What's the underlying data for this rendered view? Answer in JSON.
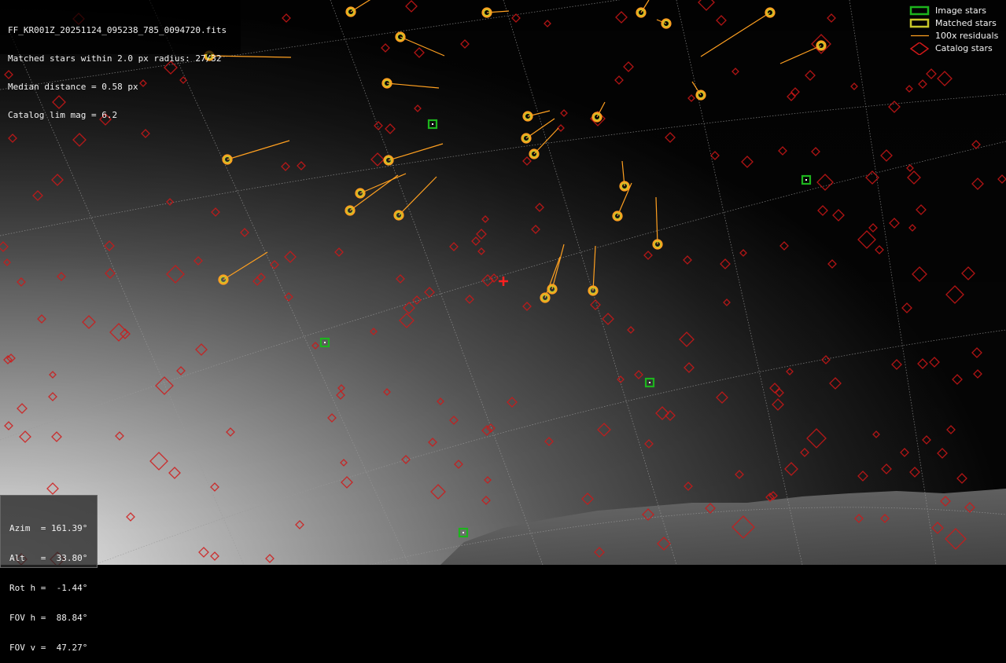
{
  "info": {
    "filename": "FF_KR001Z_20251124_095238_785_0094720.fits",
    "matched": "Matched stars within 2.0 px radius: 27/32",
    "median": "Median distance = 0.58 px",
    "catalog_lim": "Catalog lim mag = 6.2"
  },
  "pointing": {
    "azim": "Azim  = 161.39°",
    "alt": "Alt   =  33.80°",
    "rot_h": "Rot h =  -1.44°",
    "fov_h": "FOV h =  88.84°",
    "fov_v": "FOV v =  47.27°"
  },
  "legend": {
    "image_stars": "Image stars",
    "matched_stars": "Matched stars",
    "residuals": "100x residuals",
    "catalog_stars": "Catalog stars"
  },
  "colors": {
    "image_star": "#1db41d",
    "matched_star": "#c8c82a",
    "residual": "#ffa020",
    "catalog_star": "#d01818",
    "center_marker": "#ff2020",
    "grid": "#9a9a9a"
  },
  "markers": {
    "image_stars": [
      [
        550,
        158
      ],
      [
        413,
        436
      ],
      [
        826,
        487
      ],
      [
        1025,
        229
      ],
      [
        589,
        678
      ]
    ],
    "matched_stars": [
      {
        "star": [
          446,
          15
        ],
        "tip": [
          478,
          -5
        ]
      },
      {
        "star": [
          619,
          16
        ],
        "tip": [
          647,
          14
        ]
      },
      {
        "star": [
          815,
          16
        ],
        "tip": [
          825,
          0
        ]
      },
      {
        "star": [
          847,
          30
        ],
        "tip": [
          835,
          25
        ]
      },
      {
        "star": [
          979,
          16
        ],
        "tip": [
          891,
          72
        ]
      },
      {
        "star": [
          1044,
          58
        ],
        "tip": [
          992,
          81
        ]
      },
      {
        "star": [
          509,
          47
        ],
        "tip": [
          565,
          71
        ]
      },
      {
        "star": [
          266,
          71
        ],
        "tip": [
          370,
          73
        ]
      },
      {
        "star": [
          492,
          106
        ],
        "tip": [
          558,
          112
        ]
      },
      {
        "star": [
          891,
          121
        ],
        "tip": [
          880,
          104
        ]
      },
      {
        "star": [
          671,
          148
        ],
        "tip": [
          699,
          141
        ]
      },
      {
        "star": [
          759,
          149
        ],
        "tip": [
          769,
          130
        ]
      },
      {
        "star": [
          669,
          176
        ],
        "tip": [
          705,
          151
        ]
      },
      {
        "star": [
          679,
          196
        ],
        "tip": [
          710,
          163
        ]
      },
      {
        "star": [
          289,
          203
        ],
        "tip": [
          368,
          179
        ]
      },
      {
        "star": [
          494,
          204
        ],
        "tip": [
          563,
          183
        ]
      },
      {
        "star": [
          794,
          237
        ],
        "tip": [
          791,
          205
        ]
      },
      {
        "star": [
          458,
          246
        ],
        "tip": [
          516,
          221
        ]
      },
      {
        "star": [
          445,
          268
        ],
        "tip": [
          506,
          223
        ]
      },
      {
        "star": [
          507,
          274
        ],
        "tip": [
          555,
          225
        ]
      },
      {
        "star": [
          785,
          275
        ],
        "tip": [
          803,
          233
        ]
      },
      {
        "star": [
          836,
          311
        ],
        "tip": [
          834,
          251
        ]
      },
      {
        "star": [
          284,
          356
        ],
        "tip": [
          340,
          321
        ]
      },
      {
        "star": [
          702,
          368
        ],
        "tip": [
          717,
          311
        ]
      },
      {
        "star": [
          754,
          370
        ],
        "tip": [
          757,
          313
        ]
      },
      {
        "star": [
          693,
          379
        ],
        "tip": [
          712,
          327
        ]
      }
    ],
    "center": [
      640,
      358
    ],
    "catalog_stars": [
      [
        523,
        8,
        7
      ],
      [
        364,
        23,
        5
      ],
      [
        656,
        23,
        5
      ],
      [
        696,
        30,
        4
      ],
      [
        790,
        22,
        7
      ],
      [
        898,
        3,
        10
      ],
      [
        917,
        26,
        6
      ],
      [
        1057,
        23,
        5
      ],
      [
        591,
        56,
        5
      ],
      [
        490,
        61,
        5
      ],
      [
        533,
        67,
        6
      ],
      [
        1044,
        56,
        12
      ],
      [
        217,
        86,
        8
      ],
      [
        233,
        102,
        4
      ],
      [
        799,
        85,
        6
      ],
      [
        787,
        102,
        5
      ],
      [
        935,
        91,
        4
      ],
      [
        1030,
        96,
        6
      ],
      [
        1086,
        110,
        4
      ],
      [
        1184,
        94,
        6
      ],
      [
        1201,
        100,
        9
      ],
      [
        1173,
        107,
        5
      ],
      [
        1156,
        113,
        4
      ],
      [
        1011,
        117,
        5
      ],
      [
        1006,
        123,
        5
      ],
      [
        879,
        125,
        4
      ],
      [
        11,
        95,
        5
      ],
      [
        75,
        130,
        8
      ],
      [
        182,
        106,
        4
      ],
      [
        134,
        152,
        7
      ],
      [
        531,
        138,
        4
      ],
      [
        717,
        144,
        4
      ],
      [
        1137,
        136,
        7
      ],
      [
        760,
        151,
        9
      ],
      [
        481,
        160,
        5
      ],
      [
        496,
        164,
        6
      ],
      [
        852,
        175,
        6
      ],
      [
        713,
        163,
        4
      ],
      [
        16,
        176,
        5
      ],
      [
        101,
        178,
        8
      ],
      [
        185,
        170,
        5
      ],
      [
        480,
        203,
        8
      ],
      [
        670,
        205,
        5
      ],
      [
        909,
        198,
        5
      ],
      [
        950,
        206,
        7
      ],
      [
        995,
        192,
        5
      ],
      [
        1037,
        193,
        5
      ],
      [
        1127,
        198,
        7
      ],
      [
        1241,
        184,
        5
      ],
      [
        363,
        212,
        5
      ],
      [
        383,
        211,
        5
      ],
      [
        73,
        229,
        7
      ],
      [
        48,
        249,
        6
      ],
      [
        1049,
        232,
        10
      ],
      [
        1109,
        226,
        8
      ],
      [
        1162,
        226,
        8
      ],
      [
        1157,
        214,
        4
      ],
      [
        1243,
        234,
        7
      ],
      [
        1274,
        228,
        5
      ],
      [
        216,
        257,
        4
      ],
      [
        274,
        270,
        5
      ],
      [
        686,
        264,
        5
      ],
      [
        1046,
        268,
        6
      ],
      [
        1066,
        274,
        7
      ],
      [
        1171,
        267,
        6
      ],
      [
        617,
        279,
        4
      ],
      [
        681,
        292,
        5
      ],
      [
        311,
        296,
        5
      ],
      [
        1137,
        284,
        6
      ],
      [
        1160,
        290,
        4
      ],
      [
        1110,
        290,
        5
      ],
      [
        1102,
        305,
        11
      ],
      [
        1118,
        318,
        5
      ],
      [
        612,
        298,
        6
      ],
      [
        605,
        307,
        5
      ],
      [
        577,
        314,
        5
      ],
      [
        612,
        320,
        4
      ],
      [
        997,
        313,
        5
      ],
      [
        945,
        322,
        4
      ],
      [
        139,
        313,
        6
      ],
      [
        4,
        314,
        6
      ],
      [
        431,
        321,
        5
      ],
      [
        9,
        334,
        4
      ],
      [
        252,
        332,
        5
      ],
      [
        369,
        327,
        7
      ],
      [
        349,
        337,
        5
      ],
      [
        824,
        325,
        5
      ],
      [
        874,
        331,
        5
      ],
      [
        922,
        336,
        6
      ],
      [
        1058,
        336,
        5
      ],
      [
        1169,
        349,
        9
      ],
      [
        1231,
        348,
        8
      ],
      [
        78,
        352,
        5
      ],
      [
        140,
        348,
        6
      ],
      [
        223,
        349,
        11
      ],
      [
        327,
        358,
        5
      ],
      [
        332,
        353,
        5
      ],
      [
        509,
        355,
        5
      ],
      [
        620,
        357,
        7
      ],
      [
        628,
        354,
        5
      ],
      [
        367,
        378,
        5
      ],
      [
        546,
        372,
        6
      ],
      [
        597,
        381,
        5
      ],
      [
        27,
        359,
        5
      ],
      [
        1214,
        375,
        11
      ],
      [
        530,
        382,
        5
      ],
      [
        520,
        392,
        7
      ],
      [
        670,
        390,
        5
      ],
      [
        757,
        388,
        6
      ],
      [
        924,
        385,
        4
      ],
      [
        1153,
        392,
        6
      ],
      [
        53,
        406,
        5
      ],
      [
        113,
        410,
        8
      ],
      [
        151,
        423,
        11
      ],
      [
        159,
        425,
        6
      ],
      [
        517,
        408,
        9
      ],
      [
        773,
        406,
        7
      ],
      [
        802,
        420,
        4
      ],
      [
        475,
        422,
        4
      ],
      [
        401,
        440,
        4
      ],
      [
        256,
        445,
        7
      ],
      [
        873,
        432,
        9
      ],
      [
        1242,
        449,
        6
      ],
      [
        14,
        456,
        5
      ],
      [
        10,
        458,
        5
      ],
      [
        230,
        472,
        5
      ],
      [
        876,
        468,
        6
      ],
      [
        1004,
        473,
        4
      ],
      [
        1050,
        458,
        5
      ],
      [
        1140,
        464,
        6
      ],
      [
        1173,
        463,
        6
      ],
      [
        1188,
        461,
        6
      ],
      [
        1243,
        476,
        5
      ],
      [
        67,
        477,
        4
      ],
      [
        209,
        491,
        11
      ],
      [
        434,
        494,
        4
      ],
      [
        433,
        503,
        5
      ],
      [
        492,
        499,
        4
      ],
      [
        789,
        483,
        4
      ],
      [
        812,
        477,
        5
      ],
      [
        985,
        494,
        6
      ],
      [
        991,
        500,
        5
      ],
      [
        1062,
        488,
        7
      ],
      [
        1217,
        483,
        6
      ],
      [
        67,
        505,
        5
      ],
      [
        28,
        520,
        6
      ],
      [
        560,
        511,
        4
      ],
      [
        651,
        512,
        6
      ],
      [
        918,
        506,
        7
      ],
      [
        989,
        515,
        7
      ],
      [
        842,
        526,
        8
      ],
      [
        852,
        529,
        6
      ],
      [
        422,
        532,
        5
      ],
      [
        577,
        535,
        5
      ],
      [
        11,
        542,
        5
      ],
      [
        32,
        556,
        7
      ],
      [
        72,
        556,
        6
      ],
      [
        152,
        555,
        5
      ],
      [
        293,
        550,
        5
      ],
      [
        619,
        548,
        6
      ],
      [
        624,
        545,
        5
      ],
      [
        550,
        563,
        5
      ],
      [
        698,
        562,
        5
      ],
      [
        768,
        547,
        8
      ],
      [
        825,
        565,
        5
      ],
      [
        1038,
        558,
        12
      ],
      [
        1114,
        553,
        4
      ],
      [
        1178,
        560,
        5
      ],
      [
        1209,
        547,
        5
      ],
      [
        1150,
        576,
        5
      ],
      [
        1198,
        577,
        6
      ],
      [
        1023,
        576,
        5
      ],
      [
        202,
        587,
        11
      ],
      [
        437,
        589,
        4
      ],
      [
        516,
        585,
        5
      ],
      [
        583,
        591,
        5
      ],
      [
        222,
        602,
        7
      ],
      [
        940,
        604,
        5
      ],
      [
        1006,
        597,
        8
      ],
      [
        1097,
        606,
        6
      ],
      [
        1127,
        597,
        6
      ],
      [
        1163,
        601,
        6
      ],
      [
        1223,
        609,
        6
      ],
      [
        67,
        622,
        7
      ],
      [
        273,
        620,
        5
      ],
      [
        441,
        614,
        7
      ],
      [
        557,
        626,
        9
      ],
      [
        620,
        611,
        4
      ],
      [
        875,
        619,
        5
      ],
      [
        983,
        631,
        5
      ],
      [
        979,
        633,
        5
      ],
      [
        618,
        637,
        5
      ],
      [
        747,
        635,
        7
      ],
      [
        1202,
        638,
        6
      ],
      [
        1233,
        646,
        6
      ],
      [
        166,
        658,
        5
      ],
      [
        824,
        655,
        7
      ],
      [
        903,
        647,
        6
      ],
      [
        945,
        671,
        14
      ],
      [
        1092,
        660,
        5
      ],
      [
        1125,
        660,
        5
      ],
      [
        1192,
        672,
        7
      ],
      [
        1215,
        686,
        13
      ],
      [
        381,
        668,
        5
      ],
      [
        762,
        703,
        6
      ],
      [
        844,
        692,
        8
      ],
      [
        259,
        703,
        6
      ],
      [
        273,
        708,
        5
      ],
      [
        343,
        711,
        5
      ],
      [
        73,
        712,
        9
      ],
      [
        27,
        712,
        7
      ],
      [
        100,
        24,
        7
      ]
    ]
  }
}
